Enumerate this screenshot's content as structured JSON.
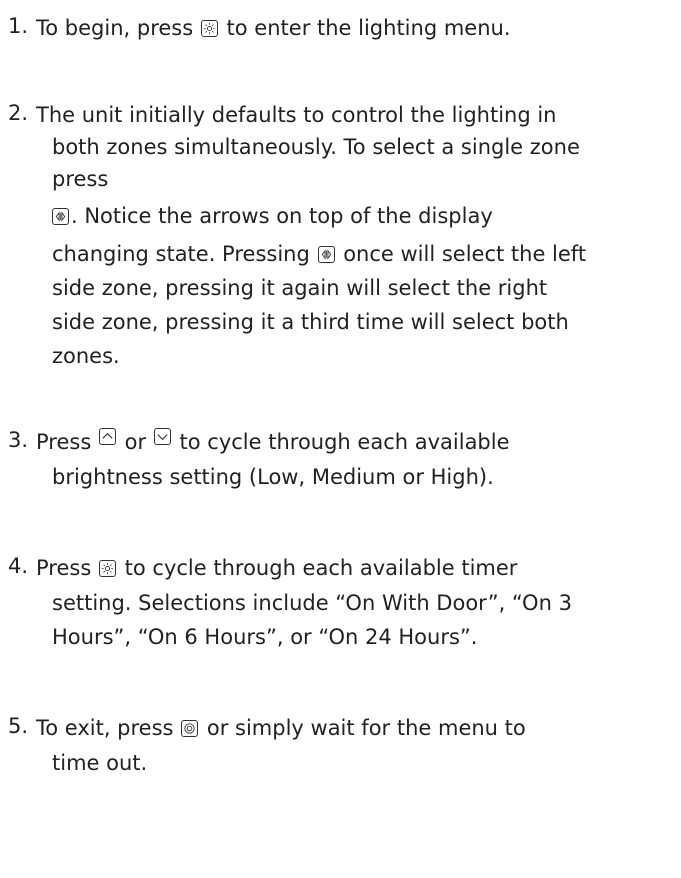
{
  "steps": [
    {
      "number": "1.",
      "lines": [
        {
          "pre": "To begin, press",
          "icon": "light-icon",
          "post": "to enter the lighting menu."
        }
      ]
    },
    {
      "number": "2.",
      "lines": [
        {
          "text": "The unit initially defaults to control the lighting in"
        },
        {
          "text": "both zones simultaneously. To select a single zone"
        },
        {
          "text": "press"
        },
        {
          "icon": "zone-select-icon",
          "post": ". Notice the arrows on top of the display"
        },
        {
          "pre": "changing state. Pressing",
          "icon": "zone-select-icon",
          "post": "once will select the left"
        },
        {
          "text": "side zone, pressing it again will select the right"
        },
        {
          "text": "side zone, pressing it a third time will select both"
        },
        {
          "text": "zones."
        }
      ]
    },
    {
      "number": "3.",
      "lines": [
        {
          "pre": "Press",
          "icon": "up-arrow-icon",
          "mid": "or",
          "icon2": "down-arrow-icon",
          "post": "to cycle through each available"
        },
        {
          "text": "brightness setting (Low, Medium or High)."
        }
      ]
    },
    {
      "number": "4.",
      "lines": [
        {
          "pre": "Press",
          "icon": "light-icon",
          "post": "to cycle through each available timer"
        },
        {
          "text": "setting. Selections include “On With Door”, “On 3"
        },
        {
          "text": "Hours”, “On 6 Hours”, or “On 24 Hours”."
        }
      ]
    },
    {
      "number": "5.",
      "lines": [
        {
          "pre": "To exit, press",
          "icon": "exit-icon",
          "post": "or simply wait for the menu to"
        },
        {
          "text": "time out."
        }
      ]
    }
  ]
}
